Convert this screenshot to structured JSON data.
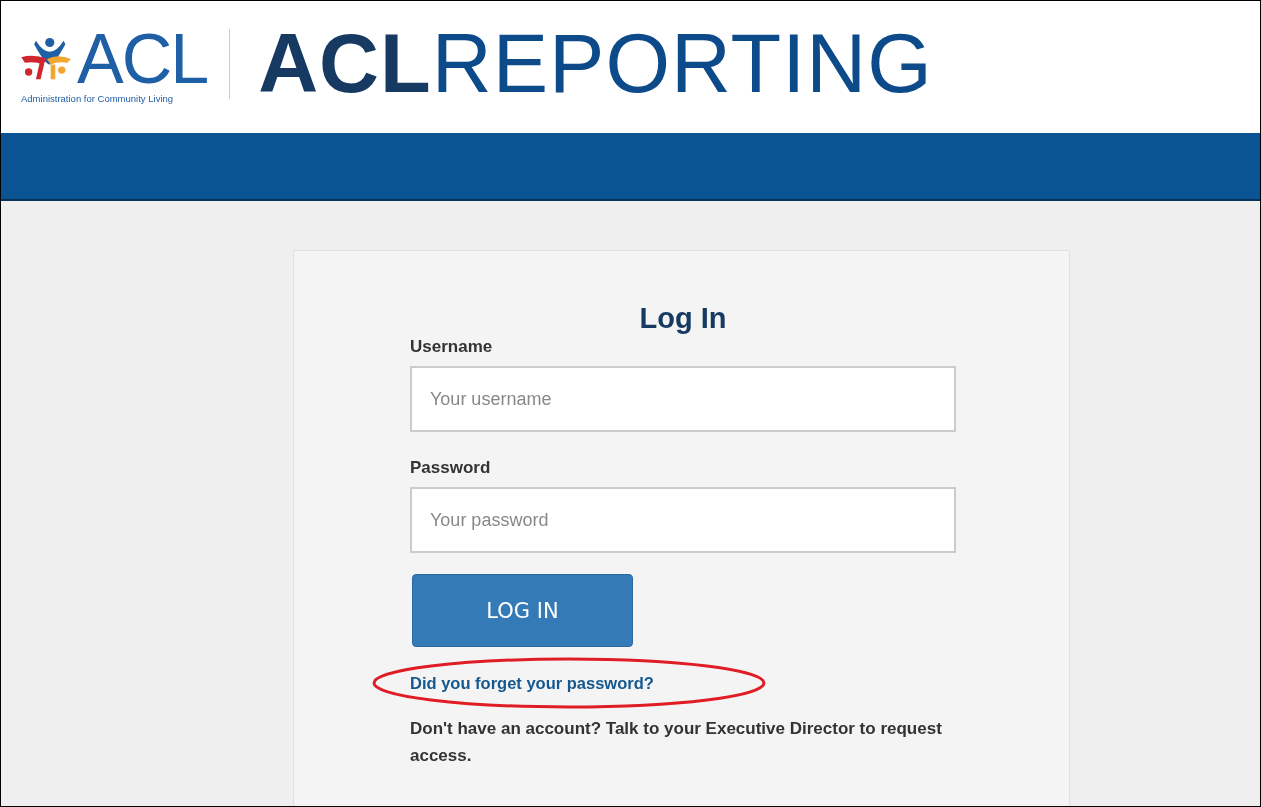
{
  "logo": {
    "mark": "ACL",
    "tagline": "Administration for Community Living"
  },
  "site_title": "**ACL**REPORTING",
  "login": {
    "title": "Log In",
    "fields": [
      {
        "label": "Username",
        "placeholder": "Your username"
      },
      {
        "label": "Password",
        "placeholder": "Your password"
      }
    ],
    "button": "LOG IN",
    "forgot_password": {
      "text": "Did you forget your password?",
      "circled": true
    },
    "signup_note": "Don't have an account? Talk to your Executive Director to request access."
  }
}
